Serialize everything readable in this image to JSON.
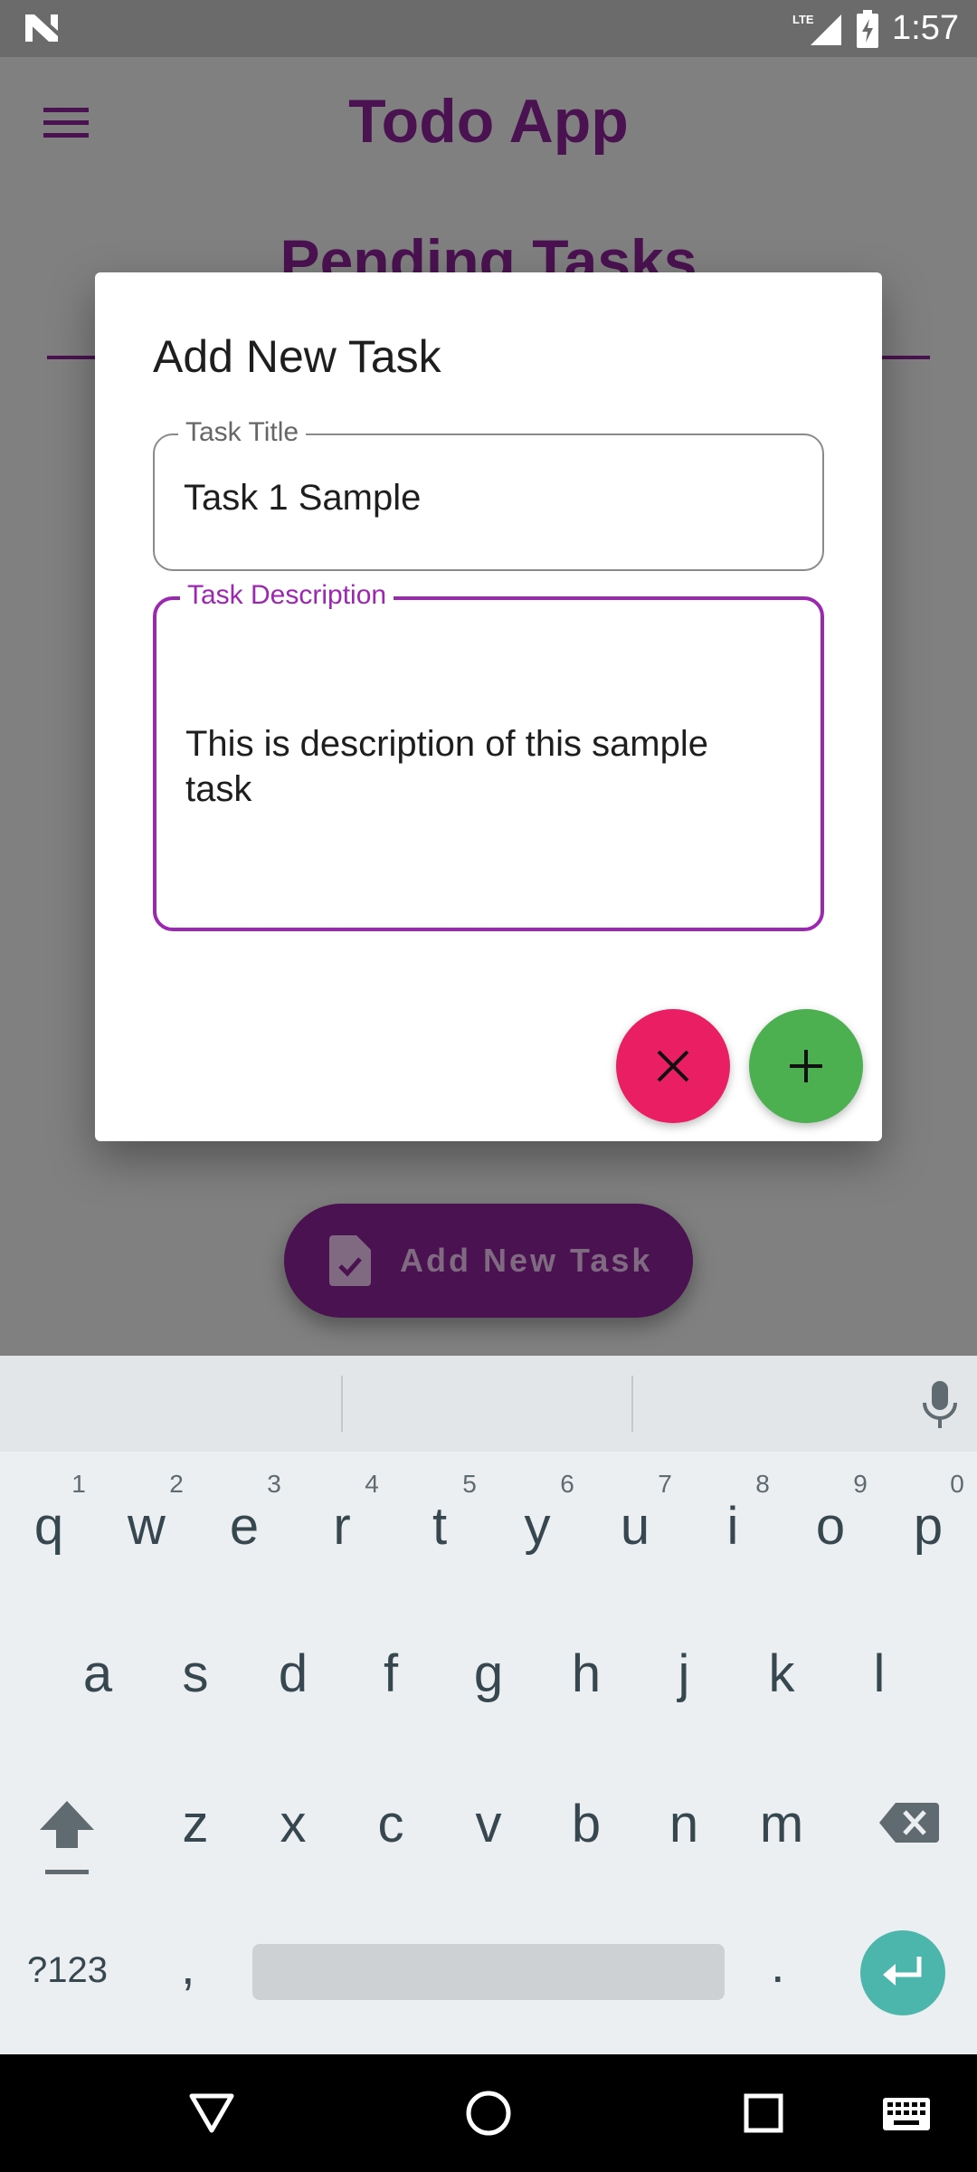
{
  "status_bar": {
    "time": "1:57",
    "network": "LTE",
    "icons": [
      "n-logo-icon",
      "lte-signal-icon",
      "battery-charging-icon"
    ]
  },
  "app": {
    "title": "Todo App",
    "section_title": "Pending Tasks",
    "fab_label": "Add New Task",
    "fab_icon": "task-document-icon",
    "primary_color": "#4a1250"
  },
  "dialog": {
    "title": "Add New Task",
    "task_title": {
      "label": "Task Title",
      "value": "Task 1 Sample"
    },
    "task_description": {
      "label": "Task Description",
      "value": "This is description of this sample task"
    },
    "cancel_icon": "close-icon",
    "add_icon": "plus-icon",
    "cancel_color": "#e91e63",
    "add_color": "#4caf50",
    "focus_color": "#9c27b0"
  },
  "keyboard": {
    "row1": [
      "q",
      "w",
      "e",
      "r",
      "t",
      "y",
      "u",
      "i",
      "o",
      "p"
    ],
    "row1_hints": [
      "1",
      "2",
      "3",
      "4",
      "5",
      "6",
      "7",
      "8",
      "9",
      "0"
    ],
    "row2": [
      "a",
      "s",
      "d",
      "f",
      "g",
      "h",
      "j",
      "k",
      "l"
    ],
    "row3": [
      "z",
      "x",
      "c",
      "v",
      "b",
      "n",
      "m"
    ],
    "symbols_key": "?123",
    "comma_key": ",",
    "period_key": ".",
    "accent_color": "#4db6ac"
  },
  "nav_bar": {
    "icons": [
      "back-icon",
      "home-icon",
      "recents-icon",
      "keyboard-switch-icon"
    ]
  }
}
